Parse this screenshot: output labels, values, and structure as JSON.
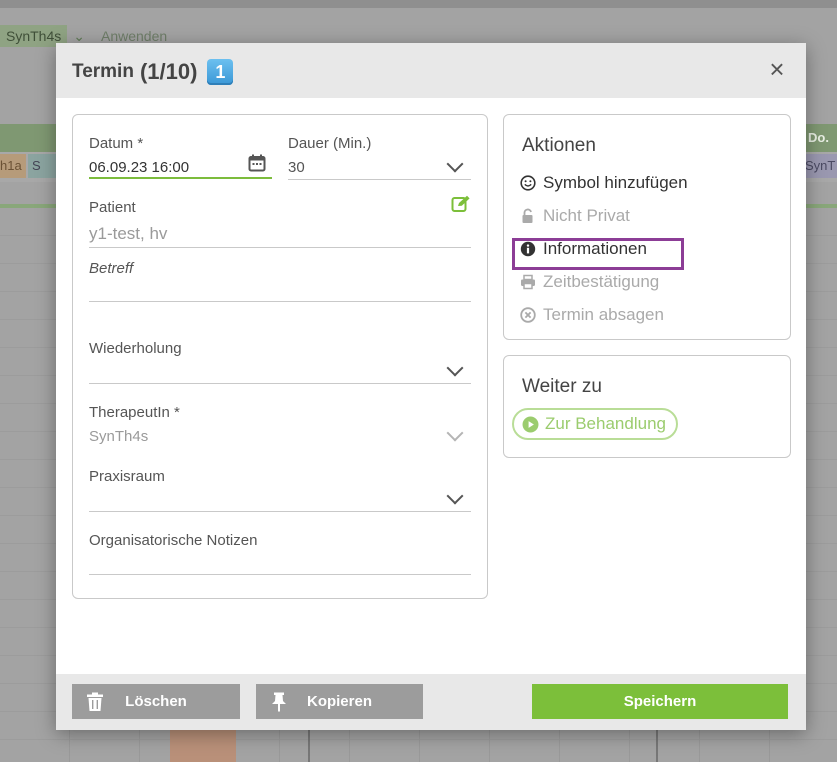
{
  "background": {
    "filter_chip": "SynTh4s",
    "apply_label": "Anwenden",
    "day_header": "Do.",
    "chip_left": "h1a",
    "chip_left2": "S",
    "chip_right": "SynT"
  },
  "modal": {
    "title": "Termin",
    "counter": "(1/10)",
    "keycap": "1",
    "close_label": "×"
  },
  "form": {
    "datum_label": "Datum *",
    "datum_value": "06.09.23 16:00",
    "dauer_label": "Dauer (Min.)",
    "dauer_value": "30",
    "patient_label": "Patient",
    "patient_value": "y1-test, hv",
    "betreff_label": "Betreff",
    "betreff_value": "",
    "wiederholung_label": "Wiederholung",
    "wiederholung_value": "",
    "therapeut_label": "TherapeutIn *",
    "therapeut_value": "SynTh4s",
    "praxisraum_label": "Praxisraum",
    "praxisraum_value": "",
    "notizen_label": "Organisatorische Notizen",
    "notizen_value": ""
  },
  "actions": {
    "title": "Aktionen",
    "items": [
      {
        "label": "Symbol hinzufügen",
        "icon": "smiley-icon",
        "enabled": true
      },
      {
        "label": "Nicht Privat",
        "icon": "unlock-icon",
        "enabled": false
      },
      {
        "label": "Informationen",
        "icon": "info-icon",
        "enabled": true
      },
      {
        "label": "Zeitbestätigung",
        "icon": "printer-icon",
        "enabled": false
      },
      {
        "label": "Termin absagen",
        "icon": "cancel-circle-icon",
        "enabled": false
      }
    ]
  },
  "weiter": {
    "title": "Weiter zu",
    "behandlung_label": "Zur Behandlung"
  },
  "footer": {
    "delete_label": "Löschen",
    "copy_label": "Kopieren",
    "save_label": "Speichern"
  },
  "colors": {
    "accent_green": "#7cbf3a",
    "highlight_purple": "#8c3d96",
    "header_grey": "#e8e8e8"
  }
}
